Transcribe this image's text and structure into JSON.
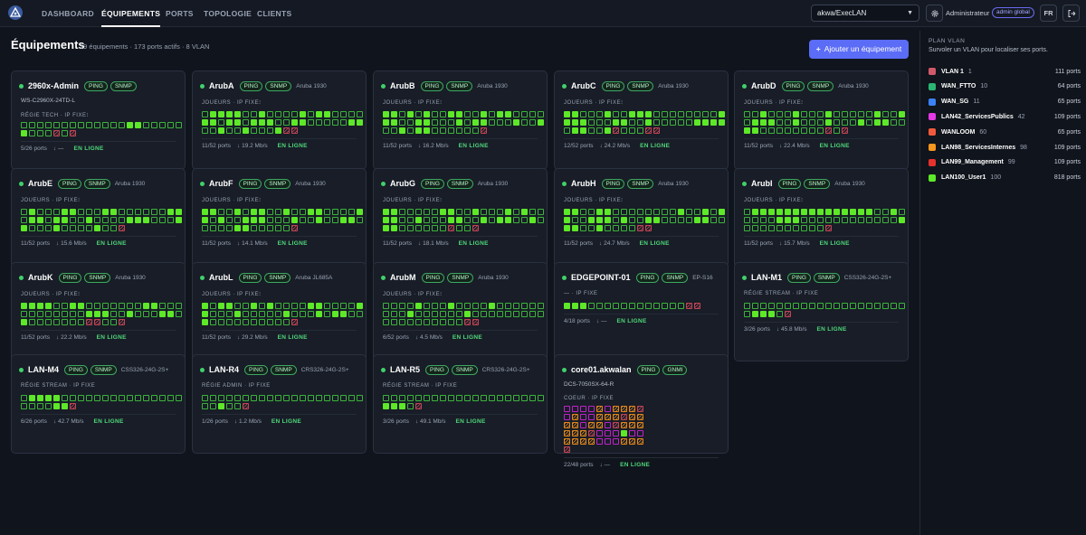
{
  "nav": {
    "items": [
      "DASHBOARD",
      "ÉQUIPEMENTS",
      "PORTS",
      "TOPOLOGIE",
      "CLIENTS"
    ],
    "site": "akwa/ExecLAN",
    "user": "Administrateur",
    "role": "admin global",
    "lang": "FR"
  },
  "page": {
    "title": "Équipements",
    "subtitle": "19 équipements · 173 ports actifs · 8 VLAN",
    "add_button": "Ajouter un équipement"
  },
  "devices": [
    {
      "name": "2960x-Admin",
      "protocols": [
        "PING",
        "SNMP"
      ],
      "model": "",
      "model_line": "WS-C2960X-24TD-L",
      "role": "RÉGIE TECH · IP FIXE⁝",
      "ports": "ddddddddddddduudddddudddxdx",
      "ports_summary": "5/26 ports",
      "throughput": "↓ —",
      "status": "EN LIGNE"
    },
    {
      "name": "ArubA",
      "protocols": [
        "PING",
        "SNMP"
      ],
      "model": "Aruba 1930",
      "model_line": "",
      "role": "JOUEURS · IP FIXE⁝",
      "ports": "duuuuddudddduduudddduuduuduuudduuddddduuddudduddduxx",
      "ports_summary": "11/52 ports",
      "throughput": "↓ 19.2 Mb/s",
      "status": "EN LIGNE"
    },
    {
      "name": "ArubB",
      "protocols": [
        "PING",
        "SNMP"
      ],
      "model": "Aruba 1930",
      "model_line": "",
      "role": "JOUEURS · IP FIXE⁝",
      "ports": "uudududduudduduudddduudduuddduduuddduddudduduuddddddx",
      "ports_summary": "11/52 ports",
      "throughput": "↓ 16.2 Mb/s",
      "status": "EN LIGNE"
    },
    {
      "name": "ArubC",
      "protocols": [
        "PING",
        "SNMP"
      ],
      "model": "Aruba 1930",
      "model_line": "",
      "role": "JOUEURS · IP FIXE⁝",
      "ports": "uudddudduuudddddddduuuuddduudduddddduuuuduudduxdddxx",
      "ports_summary": "12/52 ports",
      "throughput": "↓ 24.2 Mb/s",
      "status": "EN LIGNE"
    },
    {
      "name": "ArubD",
      "protocols": [
        "PING",
        "SNMP"
      ],
      "model": "Aruba 1930",
      "model_line": "",
      "role": "JOUEURS · IP FIXE⁝",
      "ports": "ddudddudddudddddudduduuudduddduddduduudduuddddddddxdx",
      "ports_summary": "11/52 ports",
      "throughput": "↓ 22.4 Mb/s",
      "status": "EN LIGNE"
    },
    {
      "name": "ArubE",
      "protocols": [
        "PING",
        "SNMP"
      ],
      "model": "Aruba 1930",
      "model_line": "",
      "role": "JOUEURS · IP FIXE⁝",
      "ports": "duddduuddduudddddduuduuduuddudddduuuddduudddudddduddx",
      "ports_summary": "11/52 ports",
      "throughput": "↓ 15.6 Mb/s",
      "status": "EN LIGNE"
    },
    {
      "name": "ArubF",
      "protocols": [
        "PING",
        "SNMP"
      ],
      "model": "Aruba 1930",
      "model_line": "",
      "role": "JOUEURS · IP FIXE⁝",
      "ports": "uudduduuddudduudddduududduuuddduddudduuddddduudddddx",
      "ports_summary": "11/52 ports",
      "throughput": "↓ 14.1 Mb/s",
      "status": "EN LIGNE"
    },
    {
      "name": "ArubG",
      "protocols": [
        "PING",
        "SNMP"
      ],
      "model": "Aruba 1930",
      "model_line": "",
      "role": "JOUEURS · IP FIXE⁝",
      "ports": "uuddddduuddudddududduudduddduudduduudduduuddddddxddx",
      "ports_summary": "11/52 ports",
      "throughput": "↓ 18.1 Mb/s",
      "status": "EN LIGNE"
    },
    {
      "name": "ArubH",
      "protocols": [
        "PING",
        "SNMP"
      ],
      "model": "Aruba 1930",
      "model_line": "",
      "role": "JOUEURS · IP FIXE⁝",
      "ports": "uudduuddddddddudduduudduuududduudddduudduudduddddxx",
      "ports_summary": "11/52 ports",
      "throughput": "↓ 24.7 Mb/s",
      "status": "EN LIGNE"
    },
    {
      "name": "ArubI",
      "protocols": [
        "PING",
        "SNMP"
      ],
      "model": "Aruba 1930",
      "model_line": "",
      "role": "JOUEURS · IP FIXE⁝",
      "ports": "duuuuuuuuuuuuuuudduddddduuudddddddddddduddddddddddx",
      "ports_summary": "11/52 ports",
      "throughput": "↓ 15.7 Mb/s",
      "status": "EN LIGNE"
    },
    {
      "name": "ArubK",
      "protocols": [
        "PING",
        "SNMP"
      ],
      "model": "Aruba 1930",
      "model_line": "",
      "role": "JOUEURS · IP FIXE⁝",
      "ports": "uuuudduuddddddduuddddddddddduuudduddduududddddddxxddx",
      "ports_summary": "11/52 ports",
      "throughput": "↓ 22.2 Mb/s",
      "status": "EN LIGNE"
    },
    {
      "name": "ArubL",
      "protocols": [
        "PING",
        "SNMP"
      ],
      "model": "Aruba JL685A",
      "model_line": "",
      "role": "JOUEURS · IP FIXE⁝",
      "ports": "uduuddududddduudddduuddduddddduddduduudduddddddddddx",
      "ports_summary": "11/52 ports",
      "throughput": "↓ 29.2 Mb/s",
      "status": "EN LIGNE"
    },
    {
      "name": "ArubM",
      "protocols": [
        "PING",
        "SNMP"
      ],
      "model": "Aruba 1930",
      "model_line": "",
      "role": "JOUEURS · IP FIXE⁝",
      "ports": "ddddudddudddduddddddddduddddddudddddddddddddddddddxx",
      "ports_summary": "6/52 ports",
      "throughput": "↓ 4.5 Mb/s",
      "status": "EN LIGNE"
    },
    {
      "name": "EDGEPOINT-01",
      "protocols": [
        "PING",
        "SNMP"
      ],
      "model": "EP-S16",
      "model_line": "",
      "role": "— · IP FIXE",
      "ports": "uuuddddddddddddxx",
      "ports_summary": "4/18 ports",
      "throughput": "↓ —",
      "status": "EN LIGNE"
    },
    {
      "name": "LAN-M1",
      "protocols": [
        "PING",
        "SNMP"
      ],
      "model": "CSS326-24G-2S+",
      "model_line": "",
      "role": "RÉGIE STREAM · IP FIXE",
      "ports": "ddddddddddddddddddddduuudx",
      "ports_summary": "3/26 ports",
      "throughput": "↓ 45.8 Mb/s",
      "status": "EN LIGNE"
    },
    {
      "name": "LAN-M4",
      "protocols": [
        "PING",
        "SNMP"
      ],
      "model": "CSS326-24G-2S+",
      "model_line": "",
      "role": "RÉGIE STREAM · IP FIXE",
      "ports": "duuuuddddddddddddddddddduux",
      "ports_summary": "6/26 ports",
      "throughput": "↓ 42.7 Mb/s",
      "status": "EN LIGNE"
    },
    {
      "name": "LAN-R4",
      "protocols": [
        "PING",
        "SNMP"
      ],
      "model": "CRS326-24G-2S+",
      "model_line": "",
      "role": "RÉGIE ADMIN · IP FIXE",
      "ports": "dddddddddddddddddddddduddx",
      "ports_summary": "1/26 ports",
      "throughput": "↓ 1.2 Mb/s",
      "status": "EN LIGNE"
    },
    {
      "name": "LAN-R5",
      "protocols": [
        "PING",
        "SNMP"
      ],
      "model": "CRS326-24G-2S+",
      "model_line": "",
      "role": "RÉGIE STREAM · IP FIXE",
      "ports": "dddddddddddddddddddduuudx",
      "ports_summary": "3/26 ports",
      "throughput": "↓ 49.1 Mb/s",
      "status": "EN LIGNE"
    },
    {
      "name": "core01.akwalan",
      "protocols": [
        "PING",
        "GNMI"
      ],
      "model": "",
      "model_line": "DCS-7050SX-64-R",
      "role": "COEUR · IP FIXE",
      "ports": "ppppopoooxpoppoooxoooopoopxooooooxpppuppoooopppooox",
      "ports_summary": "22/48 ports",
      "throughput": "↓ —",
      "status": "EN LIGNE",
      "core": true
    }
  ],
  "vlan_plan": {
    "header": "PLAN VLAN",
    "subtitle": "Survoler un VLAN pour localiser ses ports.",
    "items": [
      {
        "name": "VLAN 1",
        "id": "1",
        "count": "111 ports",
        "color": "#d2596a"
      },
      {
        "name": "WAN_FTTO",
        "id": "10",
        "count": "64 ports",
        "color": "#2bb673"
      },
      {
        "name": "WAN_SG",
        "id": "11",
        "count": "65 ports",
        "color": "#3b82f6"
      },
      {
        "name": "LAN42_ServicesPublics",
        "id": "42",
        "count": "109 ports",
        "color": "#e639e6"
      },
      {
        "name": "WANLOOM",
        "id": "60",
        "count": "65 ports",
        "color": "#f05a3c"
      },
      {
        "name": "LAN98_ServicesInternes",
        "id": "98",
        "count": "109 ports",
        "color": "#f5961e"
      },
      {
        "name": "LAN99_Management",
        "id": "99",
        "count": "109 ports",
        "color": "#e5322d"
      },
      {
        "name": "LAN100_User1",
        "id": "100",
        "count": "818 ports",
        "color": "#5de828"
      }
    ]
  }
}
